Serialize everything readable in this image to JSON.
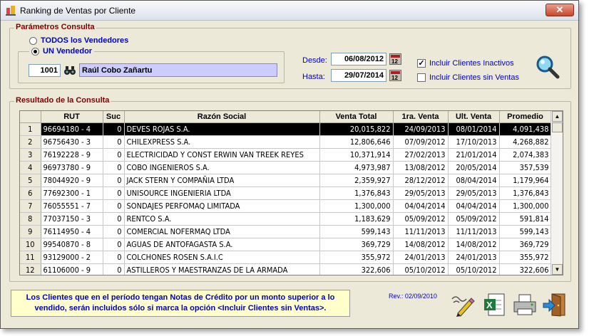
{
  "window": {
    "title": "Ranking de Ventas por Cliente"
  },
  "params": {
    "legend": "Parámetros Consulta",
    "radio_all": "TODOS los Vendedores",
    "radio_one": "UN Vendedor",
    "vendor_code": "1001",
    "vendor_name": "Raúl Cobo Zañartu",
    "desde_label": "Desde:",
    "hasta_label": "Hasta:",
    "desde": "06/08/2012",
    "hasta": "29/07/2014",
    "chk_inactivos": "Incluir Clientes Inactivos",
    "chk_sin_ventas": "Incluir Clientes sin Ventas",
    "chk_inactivos_checked": true,
    "chk_sin_ventas_checked": false
  },
  "results": {
    "legend": "Resultado de la Consulta",
    "columns": [
      "",
      "RUT",
      "Suc",
      "Razón Social",
      "Venta Total",
      "1ra. Venta",
      "Ult. Venta",
      "Promedio"
    ],
    "rows": [
      [
        "1",
        "96694180 - 4",
        "0",
        "DEVES ROJAS S.A.",
        "20,015,822",
        "24/09/2013",
        "08/01/2014",
        "4,091,438"
      ],
      [
        "2",
        "96756430 - 3",
        "0",
        "CHILEXPRESS S.A.",
        "12,806,646",
        "07/09/2012",
        "17/10/2013",
        "4,268,882"
      ],
      [
        "3",
        "76192228 - 9",
        "0",
        "ELECTRICIDAD Y CONST ERWIN VAN TREEK REYES",
        "10,371,914",
        "27/02/2013",
        "21/01/2014",
        "2,074,383"
      ],
      [
        "4",
        "96973780 - 9",
        "0",
        "COBO INGENIEROS S.A.",
        "4,973,987",
        "13/08/2012",
        "20/05/2014",
        "357,539"
      ],
      [
        "5",
        "78044920 - 9",
        "0",
        "JACK STERN Y COMPAÑIA LTDA",
        "2,359,927",
        "28/12/2012",
        "08/04/2014",
        "1,179,964"
      ],
      [
        "6",
        "77692300 - 1",
        "0",
        "UNISOURCE INGENIERIA LTDA",
        "1,376,843",
        "29/05/2013",
        "29/05/2013",
        "1,376,843"
      ],
      [
        "7",
        "76055551 - 7",
        "0",
        "SONDAJES PERFOMAQ LIMITADA",
        "1,300,000",
        "04/04/2014",
        "04/04/2014",
        "1,300,000"
      ],
      [
        "8",
        "77037150 - 3",
        "0",
        "RENTCO S.A.",
        "1,183,629",
        "05/09/2012",
        "05/09/2012",
        "591,814"
      ],
      [
        "9",
        "76114950 - 4",
        "0",
        "COMERCIAL NOFERMAQ LTDA",
        "599,143",
        "11/11/2013",
        "11/11/2013",
        "599,143"
      ],
      [
        "10",
        "99540870 - 8",
        "0",
        "AGUAS DE ANTOFAGASTA S.A.",
        "369,729",
        "14/08/2012",
        "14/08/2012",
        "369,729"
      ],
      [
        "11",
        "93129000 - 2",
        "0",
        "COLCHONES ROSEN  S.A.I.C",
        "355,972",
        "24/01/2013",
        "24/01/2013",
        "355,972"
      ],
      [
        "12",
        "61106000 - 9",
        "0",
        "ASTILLEROS Y MAESTRANZAS DE LA ARMADA",
        "322,606",
        "05/10/2012",
        "05/10/2012",
        "322,606"
      ]
    ]
  },
  "notice": {
    "line1": "Los Clientes que en el período tengan Notas de Crédito por un monto superior a lo",
    "line2": "vendido, serán incluidos sólo si marca la opción <Incluir Clientes sin Ventas>."
  },
  "rev": "Rev.: 02/09/2010",
  "icons": {
    "app": "app-icon",
    "binoculars": "binoculars-icon",
    "calendar": "calendar-icon",
    "search": "magnifier-icon",
    "edit": "pencil-edit-icon",
    "excel": "excel-icon",
    "print": "printer-icon",
    "exit": "exit-door-icon"
  }
}
